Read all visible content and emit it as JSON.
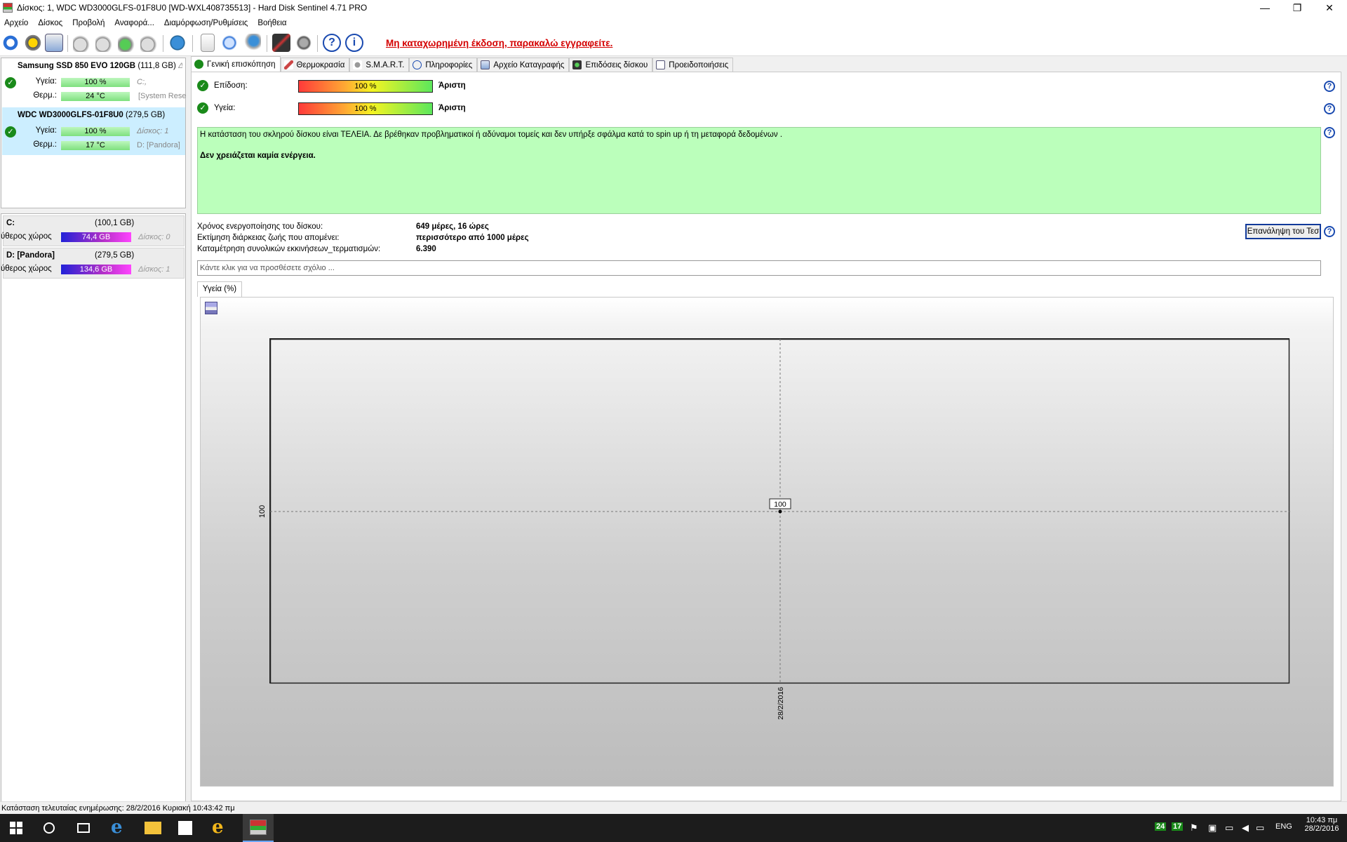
{
  "window": {
    "title": "Δίσκος: 1, WDC WD3000GLFS-01F8U0 [WD-WXL408735513]  -  Hard Disk Sentinel 4.71 PRO",
    "minimize": "—",
    "maximize": "❐",
    "close": "✕"
  },
  "menu": [
    "Αρχείο",
    "Δίσκος",
    "Προβολή",
    "Αναφορά...",
    "Διαμόρφωση/Ρυθμίσεις",
    "Βοήθεια"
  ],
  "toolbar": {
    "unregistered": "Μη καταχωρημένη έκδοση, παρακαλώ εγγραφείτε."
  },
  "disks": [
    {
      "name": "Samsung SSD 850 EVO 120GB",
      "size": "(111,8 GB)",
      "suffix": "Δί",
      "health_label": "Υγεία:",
      "health_value": "100 %",
      "health_pct": 100,
      "health_extra": "C:,",
      "temp_label": "Θερμ.:",
      "temp_value": "24 °C",
      "temp_extra": "[System Rese"
    },
    {
      "name": "WDC WD3000GLFS-01F8U0",
      "size": "(279,5 GB)",
      "health_label": "Υγεία:",
      "health_value": "100 %",
      "health_pct": 100,
      "health_extra": "Δίσκος: 1",
      "temp_label": "Θερμ.:",
      "temp_value": "17 °C",
      "temp_extra": "D: [Pandora]"
    }
  ],
  "partitions": [
    {
      "name": "C:",
      "size": "(100,1 GB)",
      "free_label": "ύθερος χώρος",
      "free_value": "74,4 GB",
      "disk": "Δίσκος: 0"
    },
    {
      "name": "D: [Pandora]",
      "size": "(279,5 GB)",
      "free_label": "ύθερος χώρος",
      "free_value": "134,6 GB",
      "disk": "Δίσκος: 1"
    }
  ],
  "tabs": [
    "Γενική επισκόπηση",
    "Θερμοκρασία",
    "S.M.A.R.T.",
    "Πληροφορίες",
    "Αρχείο Καταγραφής",
    "Επιδόσεις δίσκου",
    "Προειδοποιήσεις"
  ],
  "overview": {
    "performance_label": "Επίδοση:",
    "performance_value": "100 %",
    "performance_pct": 100,
    "performance_rating": "Άριστη",
    "health_label": "Υγεία:",
    "health_value": "100 %",
    "health_pct": 100,
    "health_rating": "Άριστη",
    "status_text": "Η κατάσταση του σκληρού δίσκου είναι ΤΕΛΕΙΑ. Δε βρέθηκαν προβληματικοί ή αδύναμοι τομείς και δεν υπήρξε σφάλμα κατά το spin up ή τη μεταφορά δεδομένων .",
    "status_action": "Δεν χρειάζεται καμία ενέργεια.",
    "info": [
      {
        "label": "Χρόνος ενεργοποίησης του δίσκου:",
        "value": "649 μέρες, 16 ώρες"
      },
      {
        "label": "Εκτίμηση διάρκειας ζωής που απομένει:",
        "value": "περισσότερο από 1000 μέρες"
      },
      {
        "label": "Καταμέτρηση συνολικών εκκινήσεων_τερματισμών:",
        "value": "6.390"
      }
    ],
    "repeat_button": "Επανάληψη του Τεσ",
    "comment_placeholder": "Κάντε κλικ για να προσθέσετε σχόλιο ..."
  },
  "chart_tab": "Υγεία (%)",
  "chart_data": {
    "type": "line",
    "x": [
      "28/2/2016"
    ],
    "series": [
      {
        "values": [
          100
        ]
      }
    ],
    "y_tick": "100",
    "data_label": "100",
    "grid": true
  },
  "statusbar": "Κατάσταση τελευταίας ενημέρωσης: 28/2/2016 Κυριακή 10:43:42 πμ",
  "taskbar": {
    "tray_temp1": "24",
    "tray_temp2": "17",
    "lang": "ENG",
    "time": "10:43 πμ",
    "date": "28/2/2016"
  }
}
